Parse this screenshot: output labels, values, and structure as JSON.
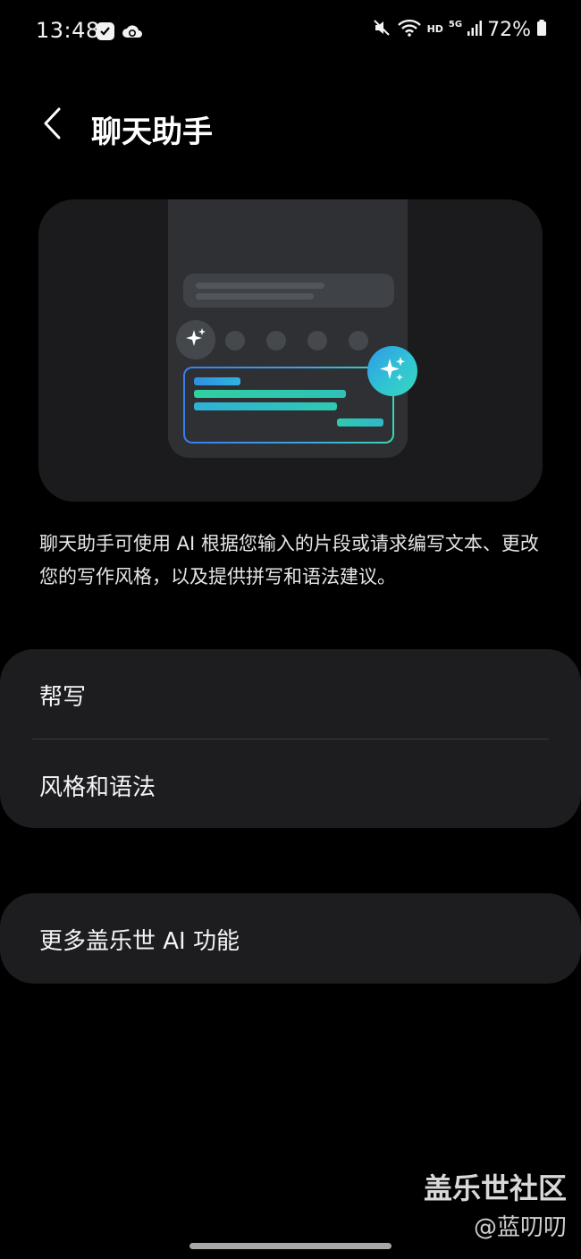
{
  "status_bar": {
    "time": "13:48",
    "notification_icons": [
      "checklist-icon",
      "cloud-sync-icon"
    ],
    "mute_icon": "mute-icon",
    "wifi_icon": "wifi-icon",
    "hd_label": "HD",
    "network_label": "5G",
    "signal_icon": "signal-bars-icon",
    "battery_percent": "72%",
    "battery_icon": "battery-icon"
  },
  "header": {
    "back_icon": "chevron-left-icon",
    "title": "聊天助手"
  },
  "illustration": {
    "ai_sparkle_icon": "sparkle-icon",
    "accent_gradient": [
      "#3a7cf2",
      "#3ad6b6"
    ]
  },
  "description": "聊天助手可使用 AI 根据您输入的片段或请求编写文本、更改您的写作风格，以及提供拼写和语法建议。",
  "settings": {
    "group_1": [
      {
        "label": "帮写"
      },
      {
        "label": "风格和语法"
      }
    ],
    "group_2": [
      {
        "label": "更多盖乐世 AI 功能"
      }
    ]
  },
  "watermark": {
    "main": "盖乐世社区",
    "sub": "@蓝叨叨"
  },
  "colors": {
    "background": "#000000",
    "card": "#1d1d20",
    "text": "#ffffff"
  }
}
